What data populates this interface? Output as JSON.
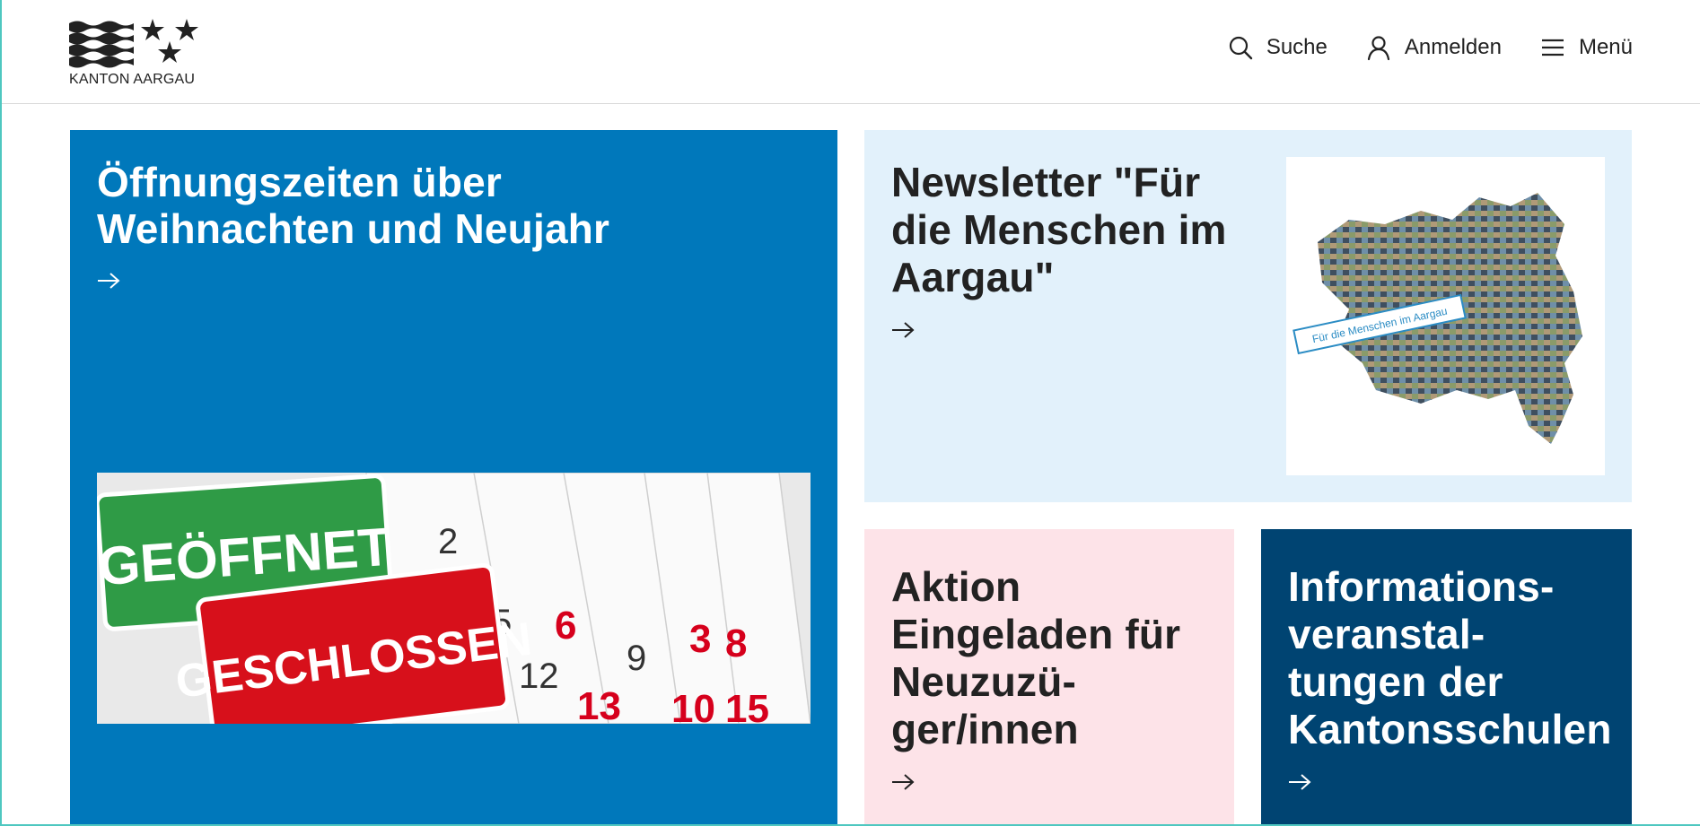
{
  "header": {
    "logo_text": "KANTON AARGAU",
    "nav": [
      {
        "label": "Suche",
        "icon": "search-icon"
      },
      {
        "label": "Anmelden",
        "icon": "user-icon"
      },
      {
        "label": "Menü",
        "icon": "hamburger-menu-icon"
      }
    ]
  },
  "tiles": [
    {
      "title": "Öffnungszeiten über Weihnachten und Neujahr",
      "image": {
        "sign_green": "GEÖFFNET",
        "sign_red": "GESCHLOSSEN"
      }
    },
    {
      "title": "Newsletter \"Für die Menschen im Aargau\"",
      "image": {
        "caption": "Für die Menschen im Aargau"
      }
    },
    {
      "title": "Aktion Eingeladen für Neuzuzü-ger/innen"
    },
    {
      "title": "Informations-veranstal-tungen der Kantonsschulen"
    }
  ],
  "colors": {
    "tile_blue": "#0078bb",
    "tile_light_blue": "#e2f1fb",
    "tile_pink": "#fde3e8",
    "tile_dark_blue": "#004472",
    "accent_teal": "#4fc7c0"
  }
}
